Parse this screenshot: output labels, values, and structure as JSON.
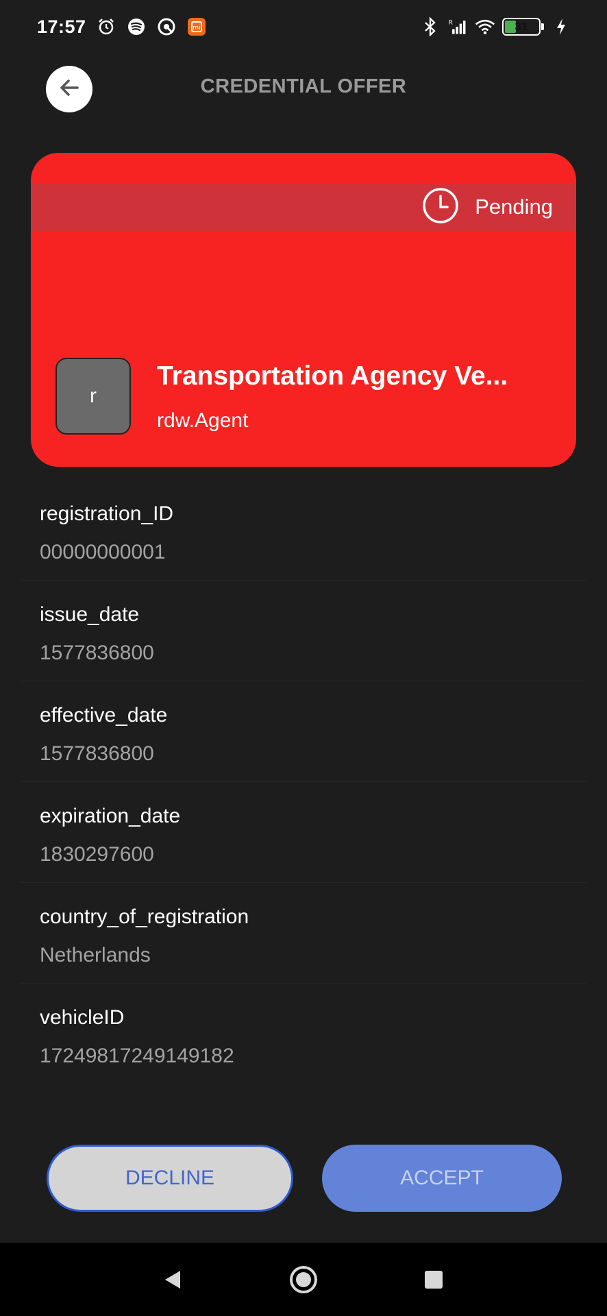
{
  "status_bar": {
    "time": "17:57",
    "battery_level": "31",
    "battery_fraction": 0.31,
    "icons_left": [
      "alarm-icon",
      "spotify-icon",
      "app-icon",
      "mi-icon"
    ],
    "icons_right": [
      "bluetooth-icon",
      "signal-icon",
      "wifi-icon",
      "battery-icon",
      "charging-icon"
    ]
  },
  "header": {
    "title": "CREDENTIAL OFFER",
    "back_icon": "arrow-left-icon"
  },
  "card": {
    "status": "Pending",
    "status_icon": "clock-icon",
    "avatar_letter": "r",
    "title": "Transportation Agency Ve...",
    "subtitle": "rdw.Agent",
    "color": "#f72323"
  },
  "attributes": [
    {
      "label": "registration_ID",
      "value": "00000000001"
    },
    {
      "label": "issue_date",
      "value": "1577836800"
    },
    {
      "label": "effective_date",
      "value": "1577836800"
    },
    {
      "label": "expiration_date",
      "value": "1830297600"
    },
    {
      "label": "country_of_registration",
      "value": "Netherlands"
    },
    {
      "label": "vehicleID",
      "value": "17249817249149182"
    }
  ],
  "actions": {
    "decline_label": "DECLINE",
    "accept_label": "ACCEPT"
  },
  "nav": {
    "back_icon": "nav-back-icon",
    "home_icon": "nav-home-icon",
    "recents_icon": "nav-recents-icon"
  }
}
